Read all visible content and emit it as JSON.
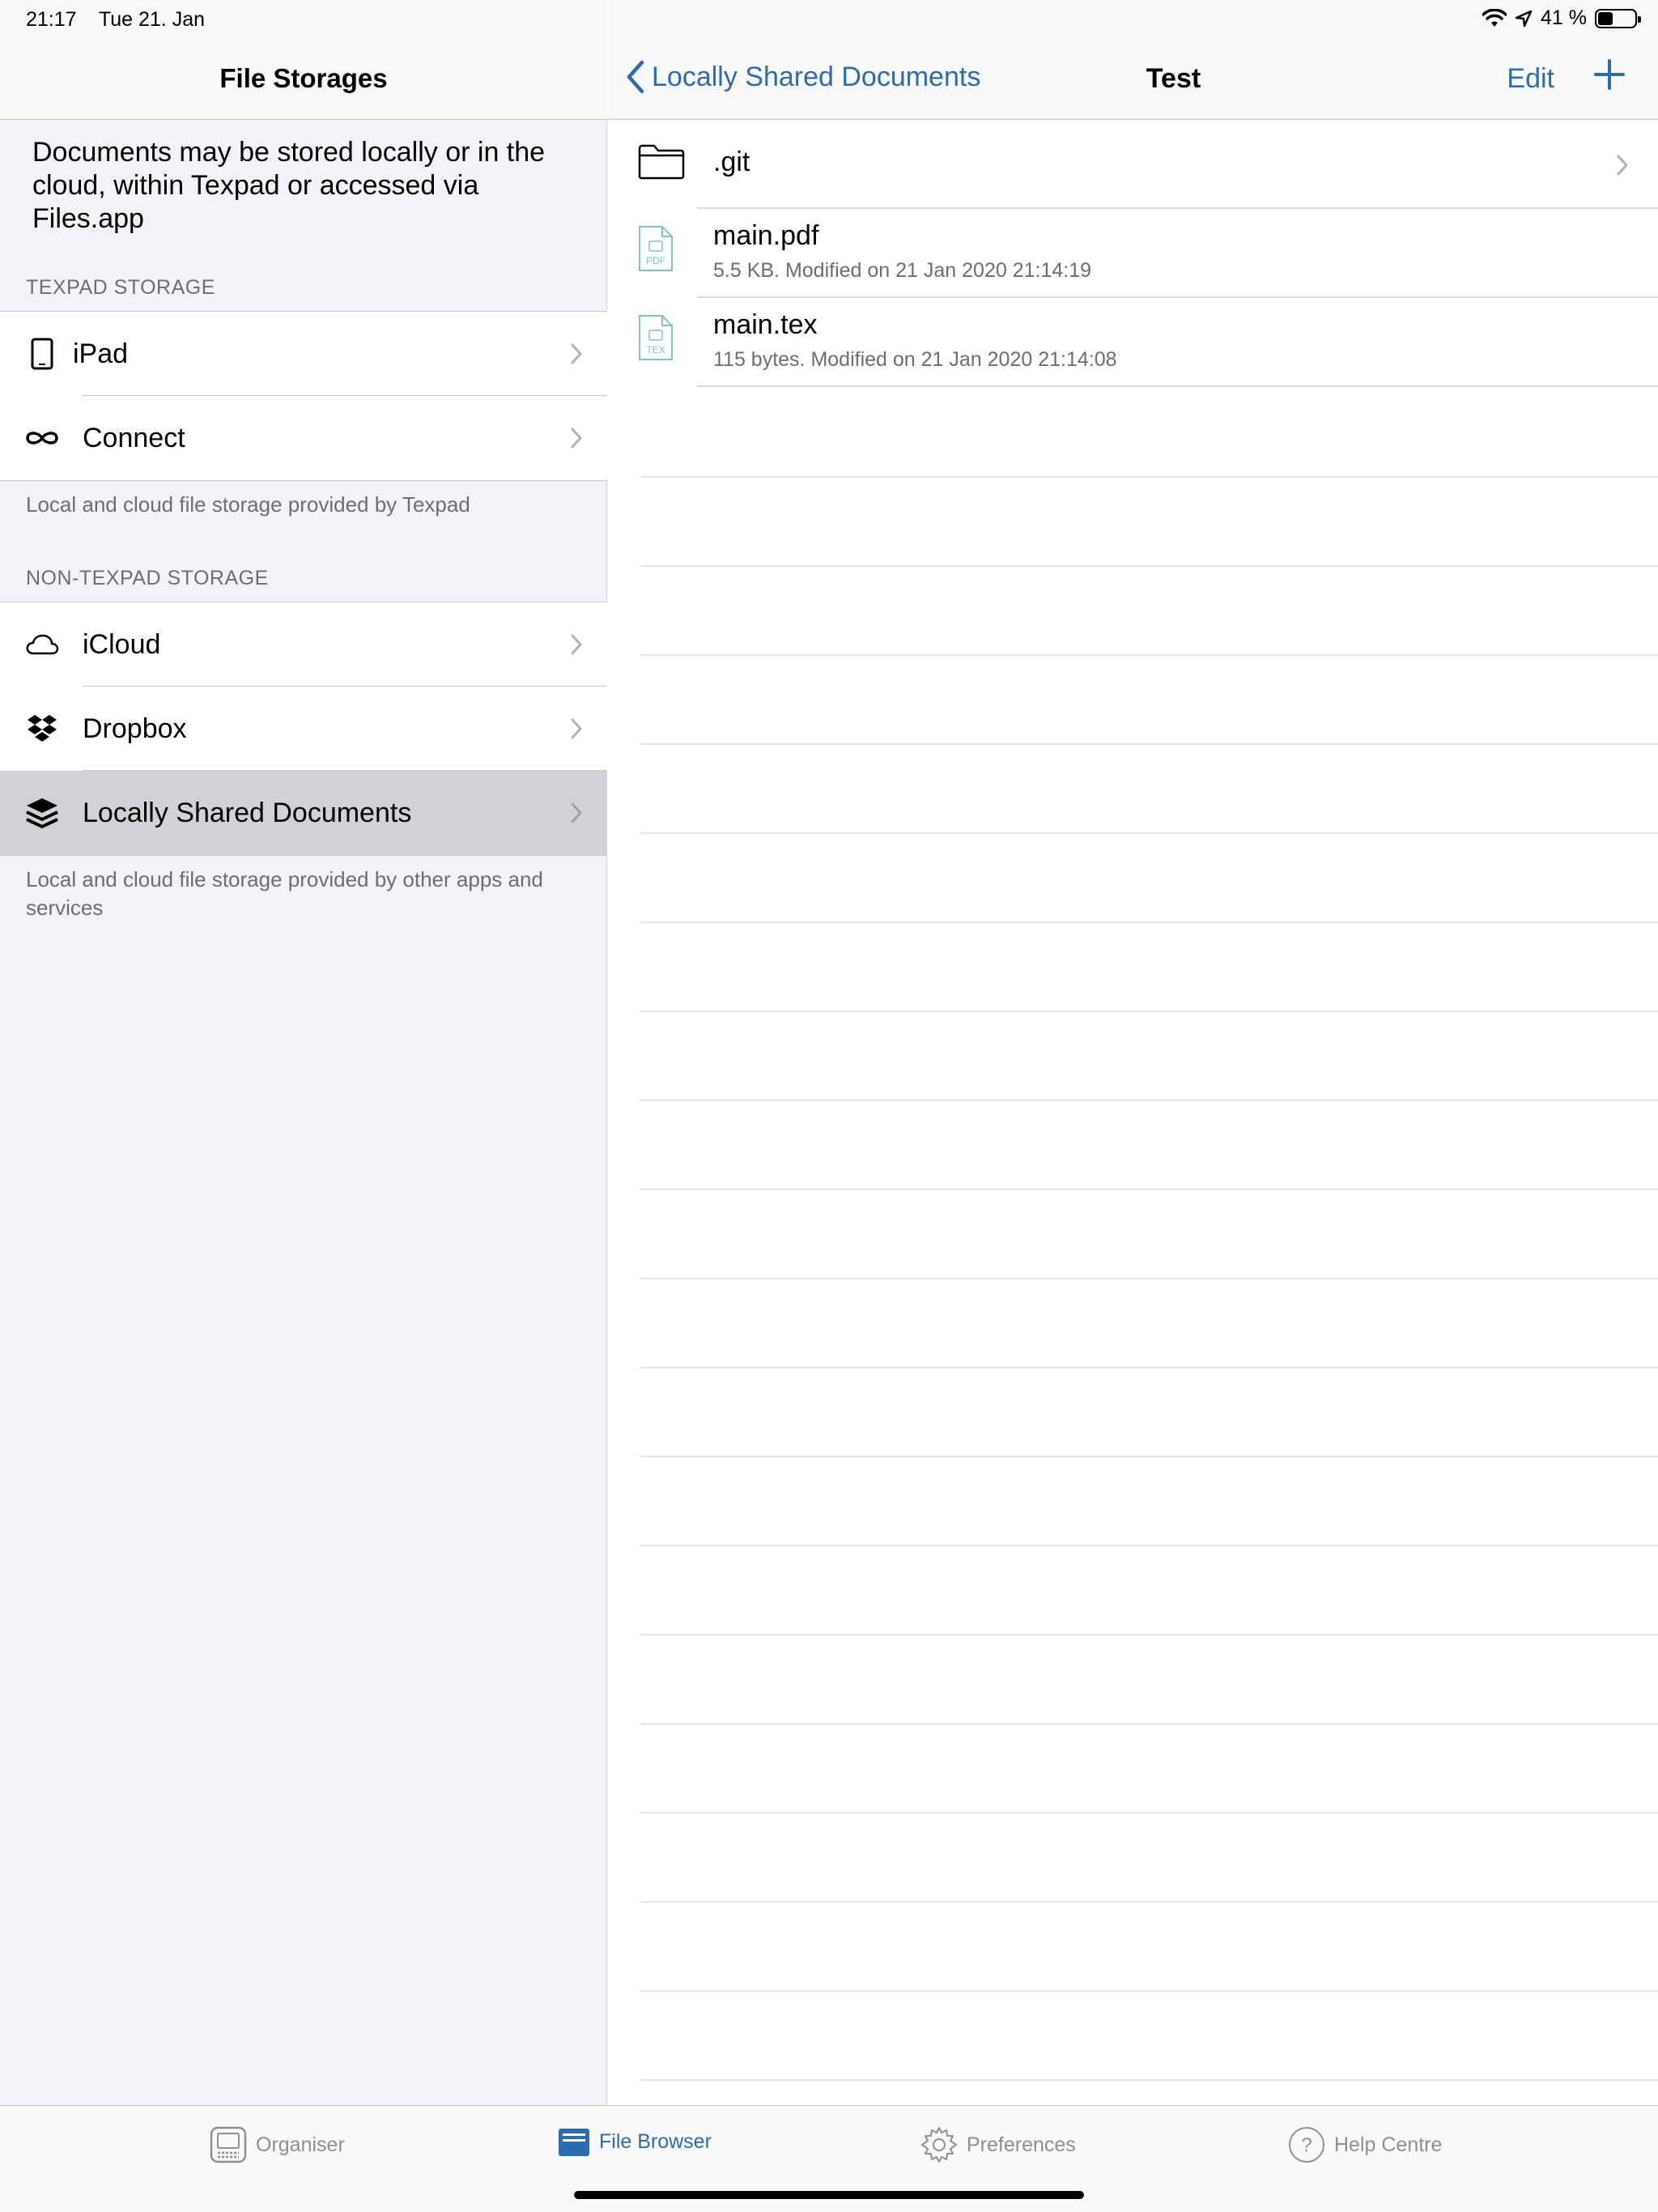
{
  "status": {
    "time": "21:17",
    "date": "Tue 21. Jan",
    "battery": "41 %",
    "battery_level": 0.41
  },
  "left": {
    "title": "File Storages",
    "intro": "Documents may be stored locally or in the cloud, within Texpad or accessed via Files.app",
    "texpad_header": "TEXPAD STORAGE",
    "texpad_items": [
      {
        "label": "iPad",
        "icon": "ipad-icon"
      },
      {
        "label": "Connect",
        "icon": "infinity-icon"
      }
    ],
    "texpad_footer": "Local and cloud file storage provided by Texpad",
    "nontexpad_header": "NON-TEXPAD STORAGE",
    "nontexpad_items": [
      {
        "label": "iCloud",
        "icon": "cloud-icon"
      },
      {
        "label": "Dropbox",
        "icon": "dropbox-icon"
      },
      {
        "label": "Locally Shared Documents",
        "icon": "layers-icon",
        "selected": true
      }
    ],
    "nontexpad_footer": "Local and cloud file storage provided by other apps and services"
  },
  "right": {
    "back_label": "Locally Shared Documents",
    "title": "Test",
    "edit_label": "Edit",
    "files": [
      {
        "name": ".git",
        "meta": "",
        "type": "folder"
      },
      {
        "name": "main.pdf",
        "meta": "5.5 KB. Modified on 21 Jan 2020  21:14:19",
        "type": "pdf",
        "badge": "PDF"
      },
      {
        "name": "main.tex",
        "meta": "115 bytes. Modified on 21 Jan 2020  21:14:08",
        "type": "tex",
        "badge": "TEX"
      }
    ]
  },
  "tabs": [
    {
      "label": "Organiser",
      "icon": "organiser-icon",
      "active": false
    },
    {
      "label": "File Browser",
      "icon": "file-browser-icon",
      "active": true
    },
    {
      "label": "Preferences",
      "icon": "gear-icon",
      "active": false
    },
    {
      "label": "Help Centre",
      "icon": "help-icon",
      "active": false
    }
  ],
  "colors": {
    "accent": "#2b6cb0",
    "file_icon": "#7fc4c9",
    "selected_row": "#d1d1d6"
  }
}
